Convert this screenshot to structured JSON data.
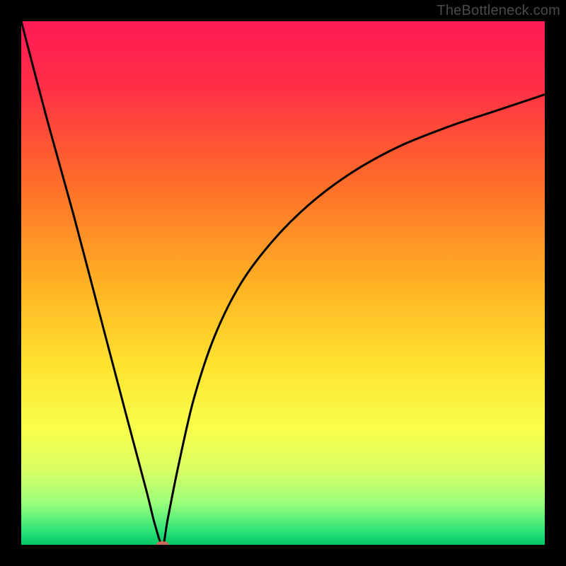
{
  "watermark": "TheBottleneck.com",
  "chart_data": {
    "type": "line",
    "title": "",
    "xlabel": "",
    "ylabel": "",
    "xlim": [
      0,
      100
    ],
    "ylim": [
      0,
      100
    ],
    "grid": false,
    "legend": false,
    "series": [
      {
        "name": "curve-left",
        "x": [
          0,
          5,
          10,
          15,
          20,
          24,
          25.5,
          27
        ],
        "y": [
          100,
          81,
          63,
          44,
          25,
          10,
          4,
          0
        ]
      },
      {
        "name": "curve-right",
        "x": [
          27,
          28,
          30,
          33,
          37,
          42,
          48,
          55,
          63,
          72,
          82,
          91,
          100
        ],
        "y": [
          0,
          5,
          15,
          28,
          40,
          50,
          58,
          65,
          71,
          76,
          80,
          83,
          86
        ]
      }
    ],
    "marker": {
      "x": 27,
      "y": 0,
      "color": "#c96a5a",
      "rx": 9,
      "ry": 5
    },
    "gradient_stops": [
      {
        "offset": 0,
        "color": "#ff1a55"
      },
      {
        "offset": 12,
        "color": "#ff2e47"
      },
      {
        "offset": 30,
        "color": "#ff6a2a"
      },
      {
        "offset": 50,
        "color": "#ffb124"
      },
      {
        "offset": 65,
        "color": "#ffe12e"
      },
      {
        "offset": 78,
        "color": "#f7ff4a"
      },
      {
        "offset": 86,
        "color": "#d7ff66"
      },
      {
        "offset": 92,
        "color": "#9bff7a"
      },
      {
        "offset": 97,
        "color": "#35e57a"
      },
      {
        "offset": 100,
        "color": "#00c864"
      }
    ]
  }
}
